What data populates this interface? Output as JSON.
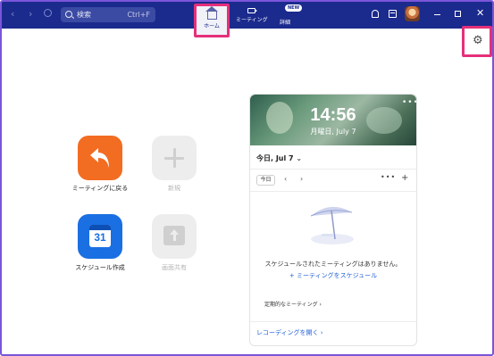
{
  "titlebar": {
    "nav_back": "‹",
    "nav_forward": "›",
    "history_icon": "clock-icon",
    "search": {
      "label": "検索",
      "shortcut": "Ctrl+F"
    },
    "tabs": [
      {
        "label": "ホーム",
        "icon": "home-icon",
        "active": true
      },
      {
        "label": "ミーティング",
        "icon": "video-camera-icon"
      },
      {
        "label": "詳細",
        "badge": "NEW",
        "icon": "more-icon"
      }
    ],
    "icons": [
      "bell-icon",
      "whiteboard-icon",
      "avatar"
    ],
    "window": {
      "close": "✕"
    },
    "colors": {
      "bar": "#1b2a8d",
      "highlight": "#e5307a"
    }
  },
  "settings": {
    "icon": "gear-icon",
    "glyph": "⚙"
  },
  "actions": [
    {
      "label": "ミーティングに戻る",
      "icon": "return-arrow-icon",
      "color": "#f26d21",
      "enabled": true
    },
    {
      "label": "新規",
      "icon": "plus-icon",
      "color": "#ededed",
      "enabled": false
    },
    {
      "label": "スケジュール作成",
      "icon": "calendar-icon",
      "calendar_day": "31",
      "color": "#1a6fe2",
      "enabled": true
    },
    {
      "label": "画面共有",
      "icon": "share-up-arrow-icon",
      "color": "#ededed",
      "enabled": false
    }
  ],
  "calendar_panel": {
    "time": "14:56",
    "date": "月曜日, July 7",
    "menu": "•••",
    "today_header": "今日, Jul 7",
    "today_button": "今日",
    "prev": "‹",
    "next": "›",
    "more": "•••",
    "add": "+",
    "empty_message": "スケジュールされたミーティングはありません。",
    "schedule_link": "+ ミーティングをスケジュール",
    "recurring": "定期的なミーティング  ›",
    "recordings": "レコーディングを開く  ›"
  }
}
